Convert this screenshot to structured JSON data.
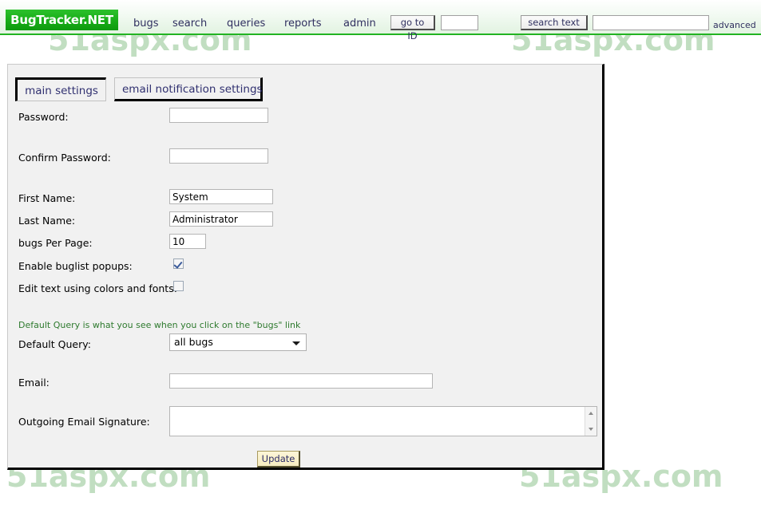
{
  "header": {
    "logo": "BugTracker.NET",
    "nav": [
      {
        "id": "bugs",
        "label": "bugs"
      },
      {
        "id": "search",
        "label": "search"
      },
      {
        "id": "queries",
        "label": "queries"
      },
      {
        "id": "reports",
        "label": "reports"
      },
      {
        "id": "admin",
        "label": "admin"
      }
    ],
    "goto_id_button": "go to ID",
    "goto_id_value": "",
    "search_text_button": "search text",
    "search_text_value": "",
    "advanced_link": "advanced",
    "accent_color": "#17ac17",
    "link_color": "#303060"
  },
  "tabs": [
    {
      "id": "main",
      "label": "main settings",
      "selected": true
    },
    {
      "id": "email",
      "label": "email notification settings",
      "selected": false
    }
  ],
  "form": {
    "password": {
      "label": "Password:",
      "value": ""
    },
    "confirm_password": {
      "label": "Confirm Password:",
      "value": ""
    },
    "first_name": {
      "label": "First Name:",
      "value": "System"
    },
    "last_name": {
      "label": "Last Name:",
      "value": "Administrator"
    },
    "bugs_per_page": {
      "label": "bugs Per Page:",
      "value": "10"
    },
    "enable_buglist_popups": {
      "label": "Enable buglist popups:",
      "checked": true
    },
    "edit_text_colors_fonts": {
      "label": "Edit text using colors and fonts:",
      "checked": false
    },
    "default_query_note": "Default Query is what you see when you click on the \"bugs\" link",
    "default_query": {
      "label": "Default Query:",
      "value": "all bugs",
      "options": [
        "all bugs"
      ]
    },
    "email": {
      "label": "Email:",
      "value": ""
    },
    "outgoing_email_signature": {
      "label": "Outgoing Email Signature:",
      "value": ""
    },
    "update_button": "Update"
  },
  "watermark": {
    "text": "51aspx.com"
  }
}
